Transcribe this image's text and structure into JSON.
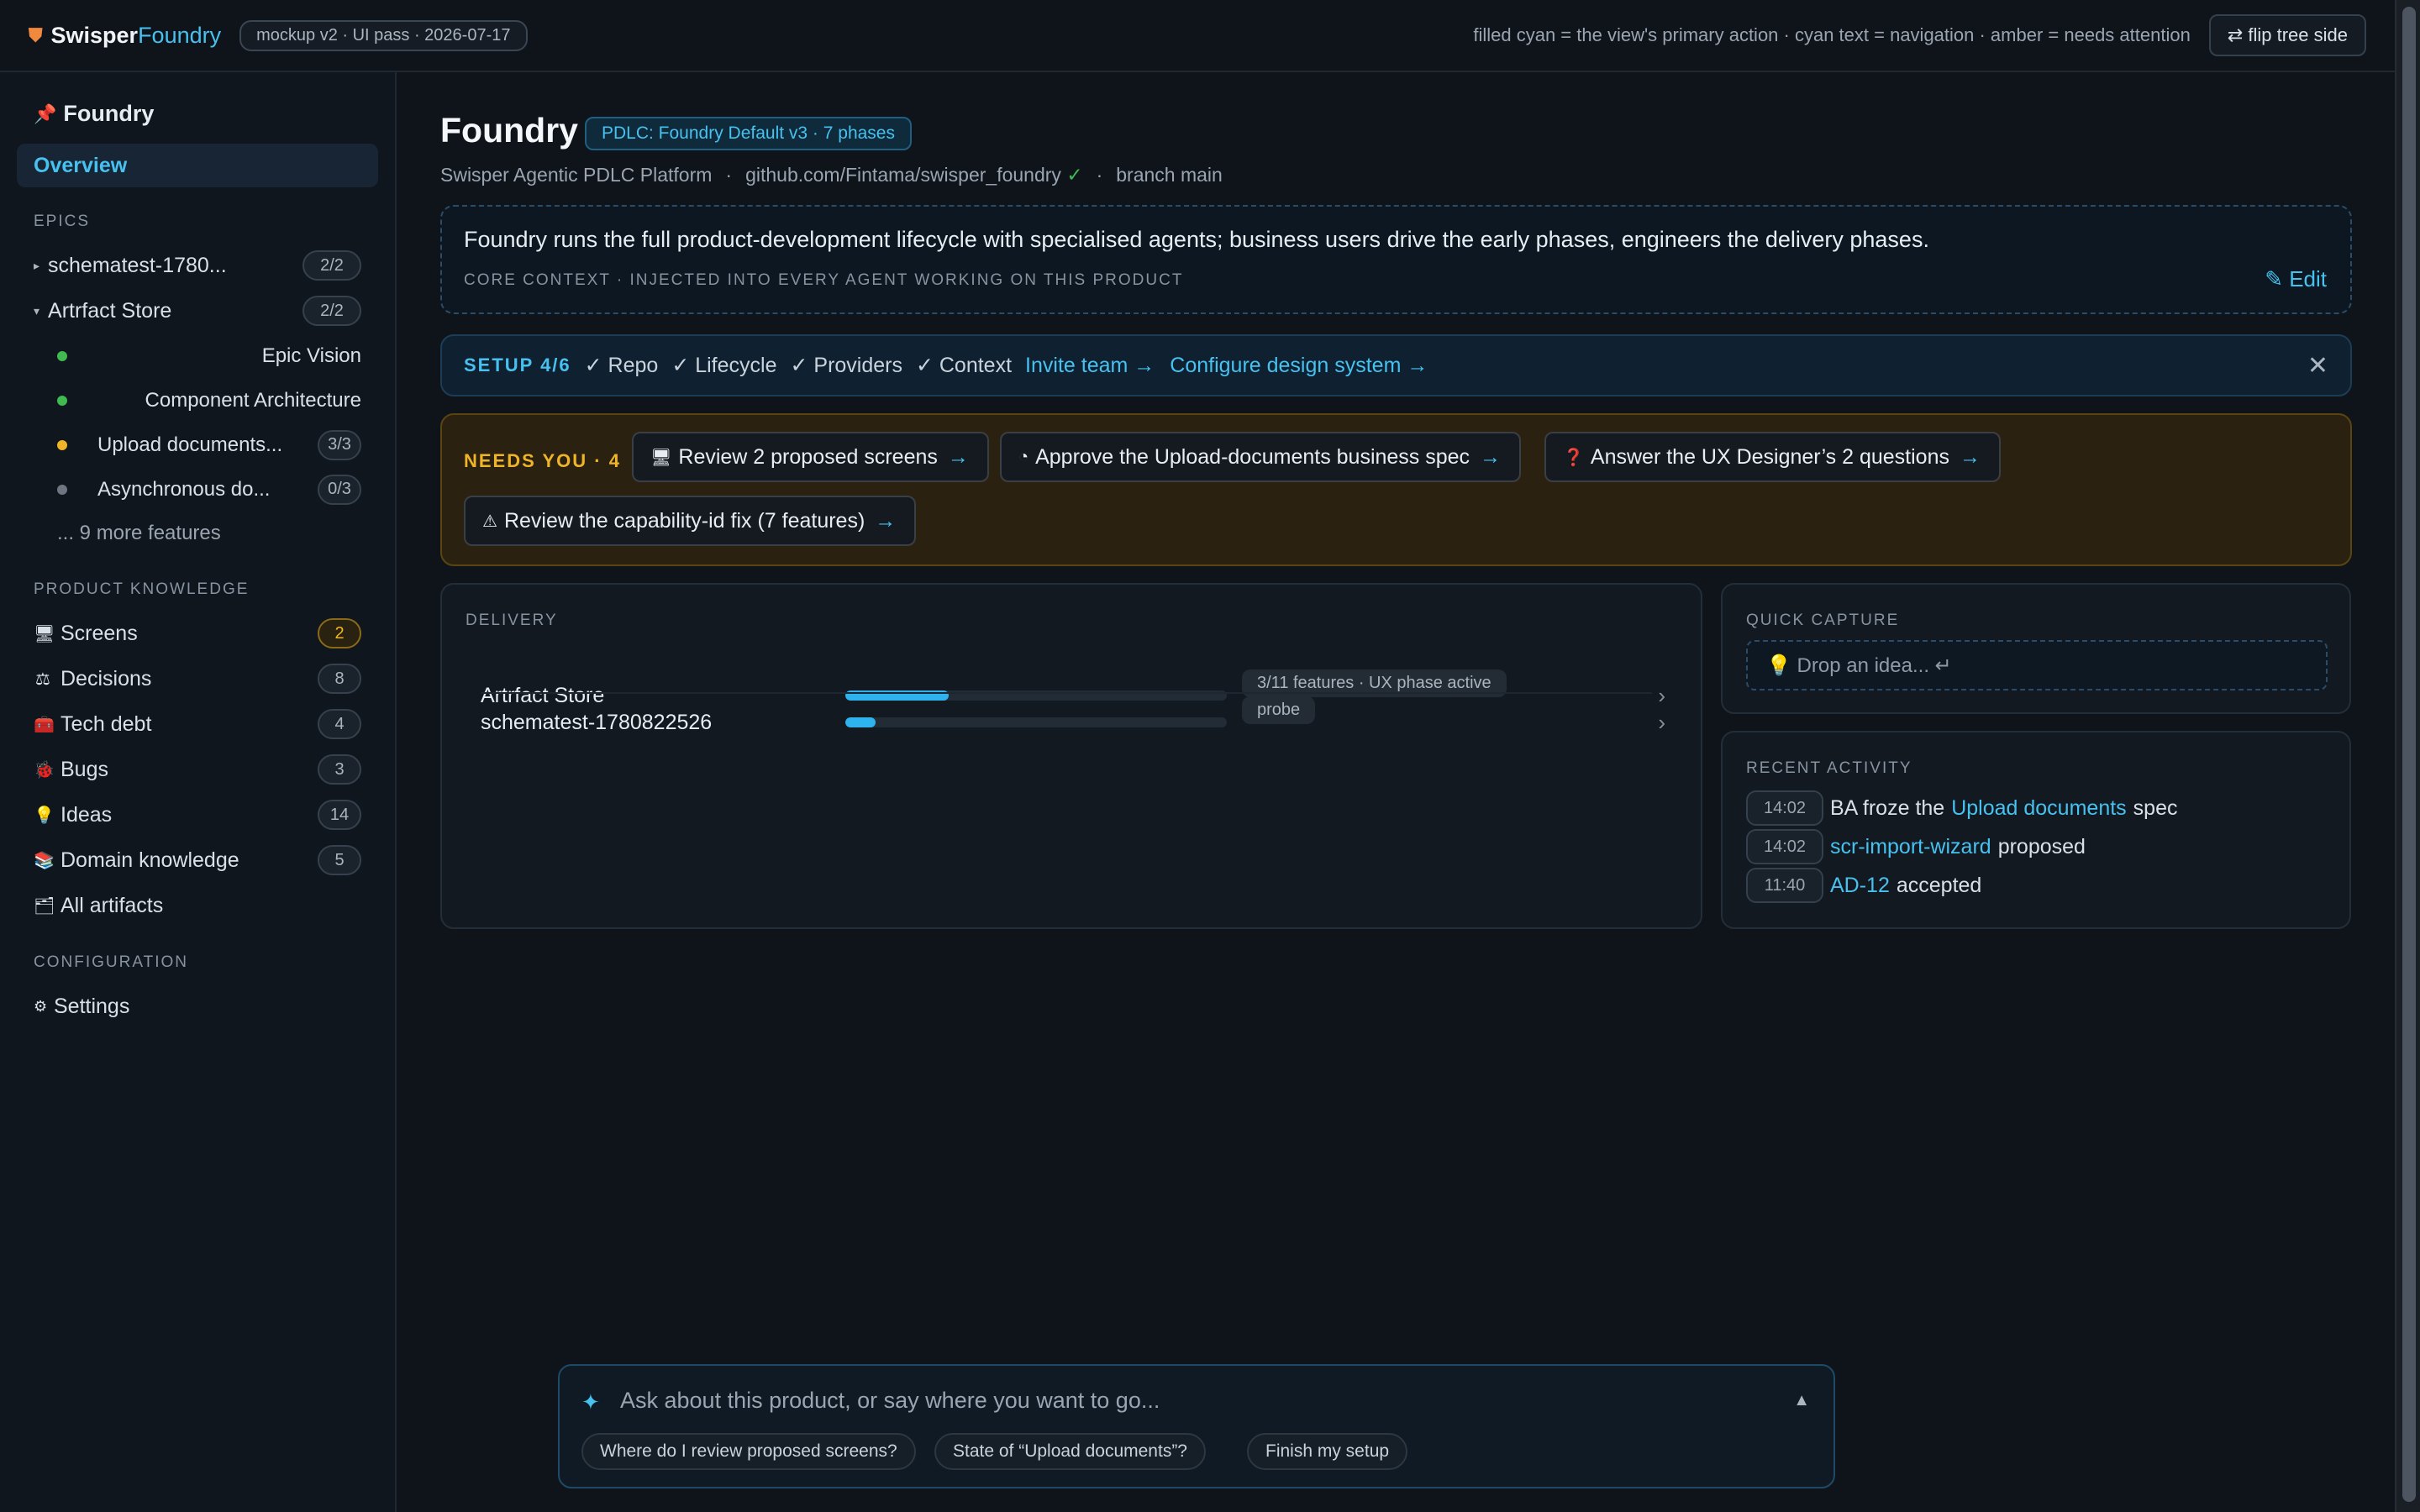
{
  "topbar": {
    "brand_a": "Swisper",
    "brand_b": "Foundry",
    "mock_pill": "mockup v2 · UI pass · 2026-07-17",
    "legend": "filled cyan = the view's primary action · cyan text = navigation · amber = needs attention",
    "flip_button": "⇄ flip tree side",
    "shield_icon": "shield-icon"
  },
  "sidebar": {
    "title": "Foundry",
    "title_icon": "pushpin-icon",
    "overview": "Overview",
    "epics_header": "EPICS",
    "epics": [
      {
        "caret": "▸",
        "label": "schematest-1780...",
        "count": "2/2"
      },
      {
        "caret": "▾",
        "label": "Artrfact Store",
        "count": "2/2"
      }
    ],
    "features": [
      {
        "label": "Epic Vision",
        "dot": "#3fb950",
        "count": ""
      },
      {
        "label": "Component Architecture",
        "dot": "#3fb950",
        "count": ""
      },
      {
        "label": "Upload documents...",
        "dot": "#f0b429",
        "count": "3/3"
      },
      {
        "label": "Asynchronous do...",
        "dot": "#6e7781",
        "count": "0/3"
      }
    ],
    "more_features": "... 9 more features",
    "knowledge_header": "PRODUCT KNOWLEDGE",
    "knowledge": [
      {
        "icon": "🖥",
        "icon_name": "monitor-icon",
        "label": "Screens",
        "count": "2",
        "amber": true
      },
      {
        "icon": "⚖",
        "icon_name": "scales-icon",
        "label": "Decisions",
        "count": "8",
        "amber": false
      },
      {
        "icon": "🧰",
        "icon_name": "toolbox-icon",
        "label": "Tech debt",
        "count": "4",
        "amber": false
      },
      {
        "icon": "🐞",
        "icon_name": "bug-icon",
        "label": "Bugs",
        "count": "3",
        "amber": false
      },
      {
        "icon": "💡",
        "icon_name": "lightbulb-icon",
        "label": "Ideas",
        "count": "14",
        "amber": false
      },
      {
        "icon": "📚",
        "icon_name": "books-icon",
        "label": "Domain knowledge",
        "count": "5",
        "amber": false
      },
      {
        "icon": "🗂",
        "icon_name": "folder-icon",
        "label": "All artifacts",
        "count": "",
        "amber": false
      }
    ],
    "config_header": "CONFIGURATION",
    "settings": "Settings",
    "settings_icon": "gear-icon"
  },
  "header": {
    "title": "Foundry",
    "pdlc_badge": "PDLC: Foundry Default v3 · 7 phases",
    "product": "Swisper Agentic PDLC Platform",
    "repo": "github.com/Fintama/swisper_foundry",
    "repo_check": "✓",
    "branch": "branch main",
    "sep": "·"
  },
  "context": {
    "text": "Foundry runs the full product-development lifecycle with specialised agents; business users drive the early phases, engineers the delivery phases.",
    "label": "CORE CONTEXT · INJECTED INTO EVERY AGENT WORKING ON THIS PRODUCT",
    "edit": "✎ Edit"
  },
  "setup": {
    "tag": "SETUP 4/6",
    "done": [
      "✓ Repo",
      "✓ Lifecycle",
      "✓ Providers",
      "✓ Context"
    ],
    "links": [
      "Invite team →",
      "Configure design system →"
    ],
    "close": "✕"
  },
  "needs": {
    "tag": "NEEDS YOU · 4",
    "arrow": "→",
    "items": [
      {
        "icon": "🖥",
        "icon_name": "monitor-icon",
        "label": "Review 2 proposed screens"
      },
      {
        "icon": "◔",
        "icon_name": "progress-icon",
        "label": "Approve the Upload-documents business spec"
      },
      {
        "icon": "❓",
        "icon_name": "question-icon",
        "label": "Answer the UX Designer’s 2 questions"
      },
      {
        "icon": "⚠",
        "icon_name": "warning-icon",
        "label": "Review the capability-id fix (7 features)"
      }
    ]
  },
  "delivery": {
    "label": "DELIVERY",
    "chevron": "›",
    "rows": [
      {
        "name": "Artrfact Store",
        "progress": 0.27,
        "status": "3/11 features · UX phase active"
      },
      {
        "name": "schematest-1780822526",
        "progress": 0.08,
        "status": "probe"
      }
    ]
  },
  "quick_capture": {
    "label": "QUICK CAPTURE",
    "placeholder": "💡 Drop an idea... ↵"
  },
  "recent_activity": {
    "label": "RECENT ACTIVITY",
    "items": [
      {
        "time": "14:02",
        "before": "BA froze the",
        "link": "Upload documents",
        "after": "spec"
      },
      {
        "time": "14:02",
        "before": "",
        "link": "scr-import-wizard",
        "after": "proposed"
      },
      {
        "time": "11:40",
        "before": "",
        "link": "AD-12",
        "after": "accepted"
      }
    ]
  },
  "ask": {
    "icon": "✦",
    "placeholder": "Ask about this product, or say where you want to go...",
    "collapse": "▲",
    "suggestions": [
      "Where do I review proposed screens?",
      "State of “Upload documents”?",
      "Finish my setup"
    ]
  },
  "colors": {
    "accent": "#47c1f0",
    "amber": "#f0b429",
    "success": "#3fb950",
    "background": "#0f141b"
  }
}
